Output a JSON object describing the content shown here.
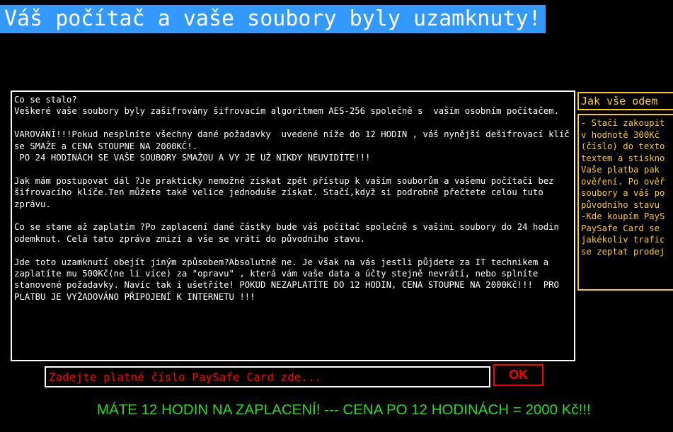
{
  "title": "Váš počítač a vaše soubory byly uzamknuty!",
  "message": {
    "paragraphs": [
      "Co se stalo?\nVeškeré vaše soubory byly zašifrovány šifrovacím algoritmem AES-256 společně s  vaším osobním počítačem.",
      "VAROVÁNÍ!!!Pokud nesplníte všechny dané požadavky  uvedené níže do 12 HODIN , váš nynější dešifrovací klíč se SMAŽE a CENA STOUPNE NA 2000KČ!.\n PO 24 HODINÁCH SE VAŠE SOUBORY SMAŽOU A VY JE UŽ NIKDY NEUVIDÍTE!!!",
      "Jak mám postupovat dál ?Je prakticky nemožné získat zpět přístup k vaším souborům a vašemu počítači bez šifrovacího klíče.Ten můžete také velice jednoduše získat. Stačí,když si podrobně přečtete celou tuto zprávu.",
      "Co se stane až zaplatím ?Po zaplacení dané částky bude váš počítač společně s vašimi soubory do 24 hodin odemknut. Celá tato zpráva zmizí a vše se vrátí do původního stavu.",
      "Jde toto uzamknutí obejít jiným způsobem?Absolutně ne. Je však na vás jestli půjdete za IT technikem a zaplatíte mu 500Kč(ne li více) za \"opravu\" , která vám vaše data a účty stejně nevrátí, nebo splníte stanovené požadavky. Navíc tak i ušetříte! POKUD NEZAPLATÍTE DO 12 HODIN, CENA STOUPNE NA 2000Kč!!!  PRO PLATBU JE VYŽADOVÁNO PŘIPOJENÍ K INTERNETU !!!"
    ]
  },
  "instructions": {
    "header": "Jak vše odem",
    "lines": [
      "- Stačí zakoupit",
      "v hodnotě 300Kč",
      "(číslo) do texto",
      "textem a stiskno",
      "Vaše platba pak",
      "ověření. Po ověř",
      "soubory a váš po",
      "původního stavu",
      "-Kde koupím PayS",
      "PaySafe Card se",
      "jakékoliv trafic",
      "se zeptat prodej"
    ]
  },
  "input": {
    "placeholder": "Zadejte platné číslo PaySafe Card zde...",
    "value": ""
  },
  "ok_button": "OK",
  "deadline_text": "MÁTE 12 HODIN NA ZAPLACENÍ!  --- CENA PO 12 HODINÁCH = 2000 Kč!!!",
  "colors": {
    "background": "#000000",
    "title_bg": "#3399ff",
    "text": "#ffffff",
    "accent_yellow": "#ffcc00",
    "accent_red": "#ff0000",
    "accent_green": "#22dd22"
  }
}
